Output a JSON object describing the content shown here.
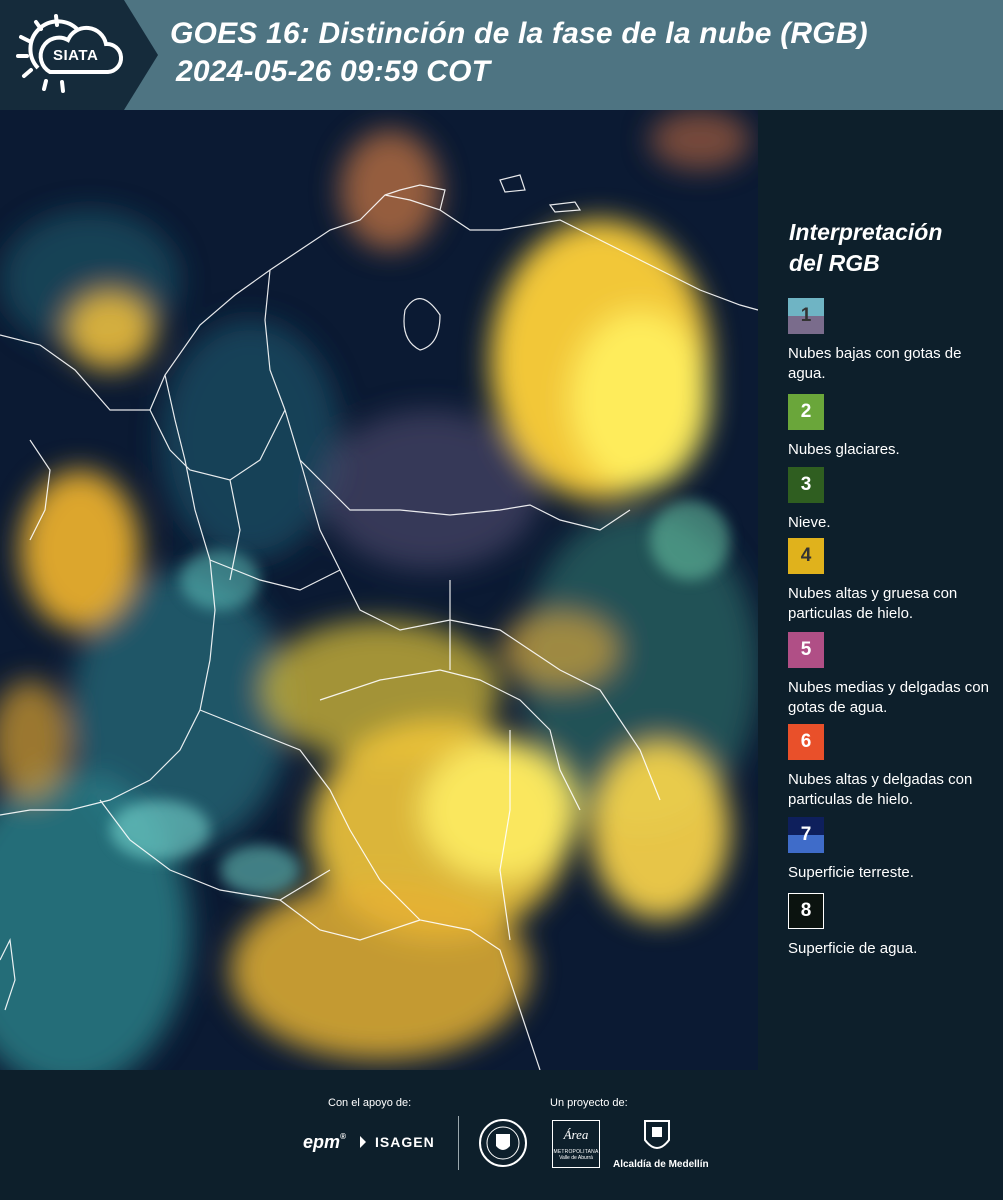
{
  "header": {
    "logo_text": "SIATA",
    "title_line1": "GOES 16: Distinción de la fase de la nube (RGB)",
    "title_line2": "2024-05-26 09:59 COT"
  },
  "legend": {
    "title_line1": "Interpretación",
    "title_line2": "del RGB",
    "items": [
      {
        "number": "1",
        "label": "Nubes bajas con gotas de agua.",
        "color_top": "#6fb4c4",
        "color_bottom": "#7a6c8c"
      },
      {
        "number": "2",
        "label": "Nubes glaciares.",
        "color": "#6aa63a"
      },
      {
        "number": "3",
        "label": "Nieve.",
        "color": "#2f5e20"
      },
      {
        "number": "4",
        "label": "Nubes altas y gruesa con particulas de hielo.",
        "color": "#e0b21c"
      },
      {
        "number": "5",
        "label": "Nubes medias y delgadas con gotas de agua.",
        "color": "#b04f86"
      },
      {
        "number": "6",
        "label": "Nubes altas y delgadas con particulas de hielo.",
        "color": "#e9502a"
      },
      {
        "number": "7",
        "label": "Superficie terreste.",
        "color_top": "#0e1f5c",
        "color_bottom": "#3f6cc9"
      },
      {
        "number": "8",
        "label": "Superficie de agua.",
        "color": "#0b130f"
      }
    ]
  },
  "footer": {
    "support_label": "Con el apoyo de:",
    "project_label": "Un proyecto de:",
    "sponsor_epm": "epm",
    "sponsor_isagen": "ISAGEN",
    "sponsor_area_1": "Área",
    "sponsor_area_2": "METROPOLITANA",
    "sponsor_area_3": "Valle de Aburrá",
    "sponsor_alcaldia": "Alcaldía de Medellín"
  }
}
